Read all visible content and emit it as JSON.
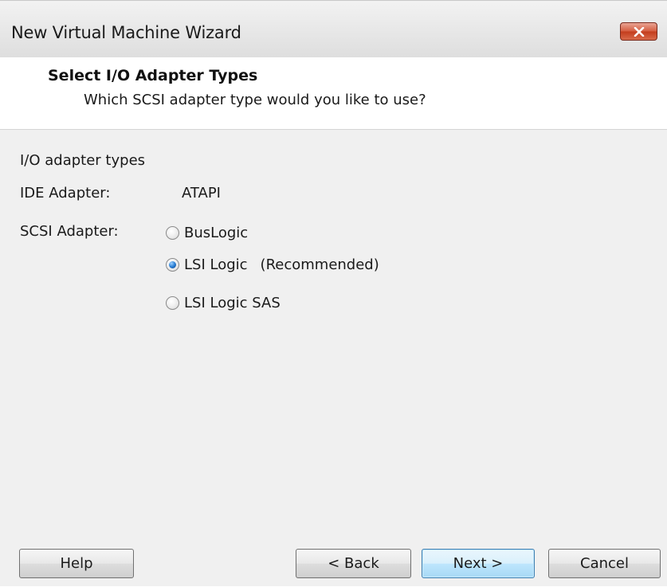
{
  "window": {
    "title": "New Virtual Machine Wizard",
    "close_icon": "close-icon"
  },
  "header": {
    "title": "Select I/O Adapter Types",
    "subtitle": "Which SCSI adapter type would you like to use?"
  },
  "adapters": {
    "group_label": "I/O adapter types",
    "ide_label": "IDE Adapter:",
    "ide_value": "ATAPI",
    "scsi_label": "SCSI Adapter:",
    "scsi_options": [
      {
        "label": "BusLogic",
        "selected": false,
        "note": ""
      },
      {
        "label": "LSI Logic",
        "selected": true,
        "note": "(Recommended)"
      },
      {
        "label": "LSI Logic SAS",
        "selected": false,
        "note": ""
      }
    ]
  },
  "buttons": {
    "help": "Help",
    "back": "< Back",
    "next": "Next >",
    "cancel": "Cancel"
  },
  "colors": {
    "close_button": "#c33c1c",
    "default_button": "#a7d9f5",
    "radio_selected": "#2a7fd4"
  }
}
